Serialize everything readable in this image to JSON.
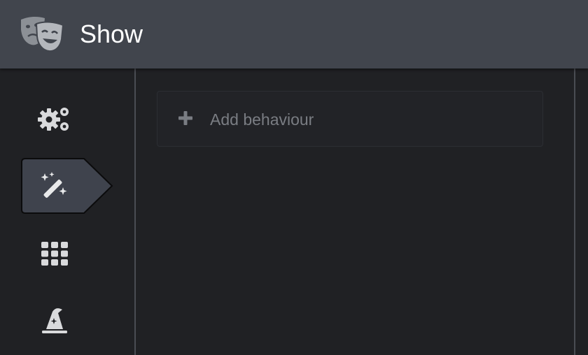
{
  "header": {
    "title": "Show",
    "logo_icon": "theater-masks-icon"
  },
  "sidebar": {
    "items": [
      {
        "id": "settings",
        "icon": "gears-icon",
        "active": false
      },
      {
        "id": "behaviours",
        "icon": "magic-wand-icon",
        "active": true
      },
      {
        "id": "grid",
        "icon": "grid-icon",
        "active": false
      },
      {
        "id": "wizard",
        "icon": "wizard-hat-icon",
        "active": false
      }
    ]
  },
  "main": {
    "add_behaviour_label": "Add behaviour",
    "add_icon": "plus-icon"
  },
  "colors": {
    "header_bg": "#41454d",
    "body_bg": "#202124",
    "active_tab_bg": "#3f434d",
    "icon": "#d9dadc",
    "muted_text": "#7a7d83"
  }
}
